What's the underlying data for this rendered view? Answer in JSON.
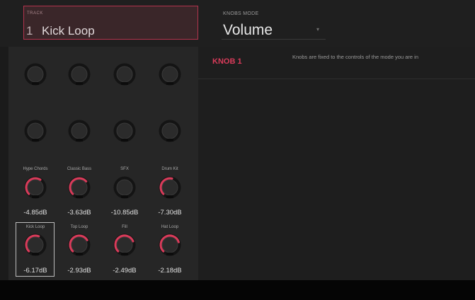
{
  "track": {
    "label": "TRACK",
    "number": "1",
    "name": "Kick Loop"
  },
  "knobs_mode": {
    "label": "KNOBS MODE",
    "value": "Volume"
  },
  "selected_knob": {
    "name": "KNOB 1",
    "description": "Knobs are fixed to the controls of the mode you are in"
  },
  "accent_color": "#d93b5a",
  "channels_row1": [
    {
      "name": "Hype Chords",
      "value": "-4.85dB",
      "level": 0.62
    },
    {
      "name": "Classic Bass",
      "value": "-3.63dB",
      "level": 0.68
    },
    {
      "name": "SFX",
      "value": "-10.85dB",
      "level": 0.0
    },
    {
      "name": "Drum Kit",
      "value": "-7.30dB",
      "level": 0.55
    }
  ],
  "channels_row2": [
    {
      "name": "Kick Loop",
      "value": "-6.17dB",
      "level": 0.58
    },
    {
      "name": "Top Loop",
      "value": "-2.93dB",
      "level": 0.72
    },
    {
      "name": "Fill",
      "value": "-2.49dB",
      "level": 0.75
    },
    {
      "name": "Hat Loop",
      "value": "-2.18dB",
      "level": 0.77
    }
  ]
}
